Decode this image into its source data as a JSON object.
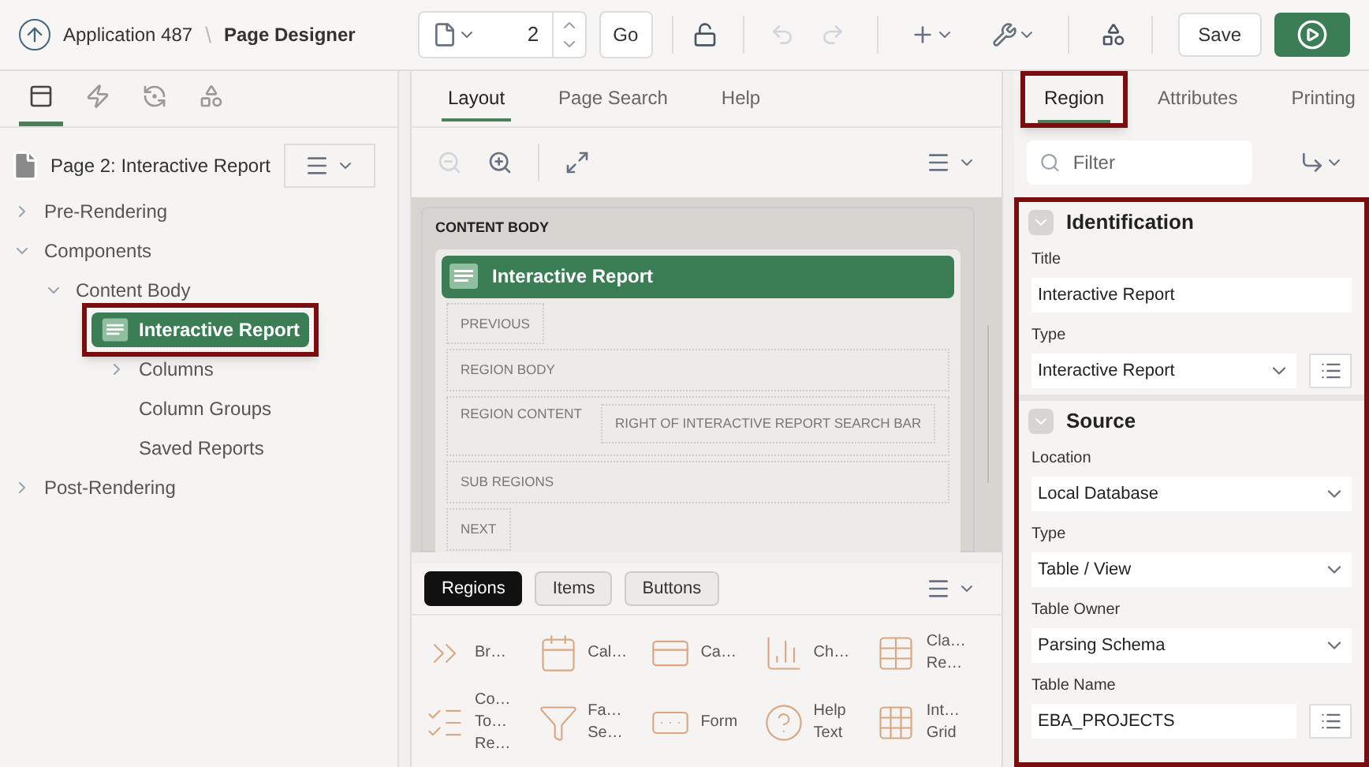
{
  "header": {
    "app": "Application 487",
    "separator": "\\",
    "page_title": "Page Designer",
    "page_number": "2",
    "go": "Go",
    "save": "Save"
  },
  "left_tabs": [
    {
      "selected": true
    },
    {
      "selected": false
    },
    {
      "selected": false
    },
    {
      "selected": false
    }
  ],
  "page_label": "Page 2: Interactive Report",
  "tree": [
    {
      "label": "Pre-Rendering",
      "selected": false,
      "expanded": false
    },
    {
      "label": "Components",
      "selected": false,
      "expanded": true,
      "children": [
        {
          "label": "Content Body",
          "selected": false,
          "expanded": true,
          "children": [
            {
              "label": "Interactive Report",
              "selected": true,
              "highlighted": true,
              "children": [
                {
                  "label": "Columns",
                  "selected": false,
                  "expanded": false
                },
                {
                  "label": "Column Groups",
                  "selected": false
                },
                {
                  "label": "Saved Reports",
                  "selected": false
                }
              ]
            }
          ]
        }
      ]
    },
    {
      "label": "Post-Rendering",
      "selected": false,
      "expanded": false
    }
  ],
  "middle_tabs": [
    {
      "label": "Layout",
      "selected": true
    },
    {
      "label": "Page Search",
      "selected": false
    },
    {
      "label": "Help",
      "selected": false
    }
  ],
  "layout": {
    "body_title": "CONTENT BODY",
    "region_title": "Interactive Report",
    "slots": [
      {
        "label": "PREVIOUS",
        "kind": "small"
      },
      {
        "label": "REGION BODY",
        "kind": "wide"
      },
      {
        "label": "REGION CONTENT",
        "kind": "split",
        "inner": "RIGHT OF INTERACTIVE REPORT SEARCH BAR"
      },
      {
        "label": "SUB REGIONS",
        "kind": "wide"
      },
      {
        "label": "NEXT",
        "kind": "small"
      }
    ]
  },
  "gallery_tabs": [
    {
      "label": "Regions",
      "selected": true
    },
    {
      "label": "Items",
      "selected": false
    },
    {
      "label": "Buttons",
      "selected": false
    }
  ],
  "gallery": [
    {
      "lines": [
        "Br…"
      ]
    },
    {
      "lines": [
        "Cal…"
      ]
    },
    {
      "lines": [
        "Ca…"
      ]
    },
    {
      "lines": [
        "Ch…"
      ]
    },
    {
      "lines": [
        "Cla…",
        "Re…"
      ]
    },
    {
      "lines": [
        "Co…",
        "To…",
        "Re…"
      ]
    },
    {
      "lines": [
        "Fa…",
        "Se…"
      ]
    },
    {
      "lines": [
        "Form"
      ]
    },
    {
      "lines": [
        "Help",
        "Text"
      ]
    },
    {
      "lines": [
        "Int…",
        "Grid"
      ]
    }
  ],
  "right_tabs": [
    {
      "label": "Region",
      "selected": true,
      "highlighted": true
    },
    {
      "label": "Attributes",
      "selected": false,
      "highlighted": false
    },
    {
      "label": "Printing",
      "selected": false,
      "highlighted": false
    }
  ],
  "filter": {
    "placeholder": "Filter"
  },
  "sections": [
    {
      "title": "Identification",
      "expanded": true,
      "fields": [
        {
          "label": "Title",
          "value": "Interactive Report",
          "kind": "text",
          "picker": false
        },
        {
          "label": "Type",
          "value": "Interactive Report",
          "kind": "select",
          "picker": true
        }
      ]
    },
    {
      "title": "Source",
      "expanded": true,
      "fields": [
        {
          "label": "Location",
          "value": "Local Database",
          "kind": "select",
          "picker": false
        },
        {
          "label": "Type",
          "value": "Table / View",
          "kind": "select",
          "picker": false
        },
        {
          "label": "Table Owner",
          "value": "Parsing Schema",
          "kind": "select",
          "picker": false
        },
        {
          "label": "Table Name",
          "value": "EBA_PROJECTS",
          "kind": "text",
          "picker": true
        }
      ]
    }
  ]
}
